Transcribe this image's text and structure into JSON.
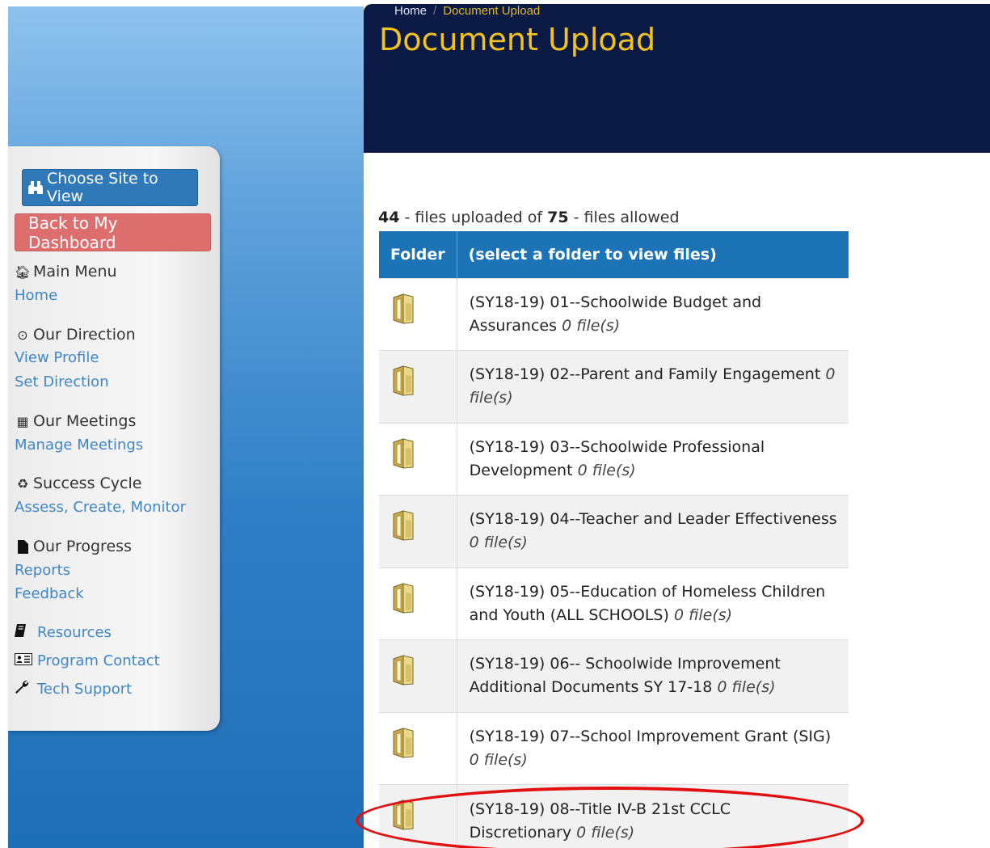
{
  "breadcrumb": {
    "home": "Home",
    "current": "Document Upload"
  },
  "page_title": "Document Upload",
  "sidebar": {
    "choose_site": "Choose Site to View",
    "back_dashboard": "Back to My Dashboard",
    "sections": [
      {
        "title": "Main Menu",
        "icon": "home-icon",
        "links": [
          "Home"
        ]
      },
      {
        "title": "Our Direction",
        "icon": "compass-icon",
        "links": [
          "View Profile",
          "Set Direction"
        ]
      },
      {
        "title": "Our Meetings",
        "icon": "calendar-icon",
        "links": [
          "Manage Meetings"
        ]
      },
      {
        "title": "Success Cycle",
        "icon": "recycle-icon",
        "links": [
          "Assess, Create, Monitor"
        ]
      },
      {
        "title": "Our Progress",
        "icon": "file-icon",
        "links": [
          "Reports",
          "Feedback"
        ]
      }
    ],
    "extra_links": [
      {
        "label": "Resources",
        "icon": "book-icon"
      },
      {
        "label": "Program Contact",
        "icon": "contact-card-icon"
      },
      {
        "label": "Tech Support",
        "icon": "wrench-icon"
      }
    ]
  },
  "summary": {
    "uploaded": "44",
    "uploaded_text": " - files uploaded of ",
    "allowed": "75",
    "allowed_text": " - files allowed"
  },
  "table": {
    "headers": [
      "Folder",
      "(select a folder to view files)"
    ],
    "rows": [
      {
        "name": "(SY18-19) 01--Schoolwide Budget and Assurances",
        "count": "0 file(s)"
      },
      {
        "name": "(SY18-19) 02--Parent and Family Engagement",
        "count": "0 file(s)"
      },
      {
        "name": "(SY18-19) 03--Schoolwide Professional Development",
        "count": "0 file(s)"
      },
      {
        "name": "(SY18-19) 04--Teacher and Leader Effectiveness",
        "count": "0 file(s)"
      },
      {
        "name": "(SY18-19) 05--Education of Homeless Children and Youth (ALL SCHOOLS)",
        "count": "0 file(s)"
      },
      {
        "name": "(SY18-19) 06-- Schoolwide Improvement Additional Documents SY 17-18",
        "count": "0 file(s)"
      },
      {
        "name": "(SY18-19) 07--School Improvement Grant (SIG)",
        "count": "0 file(s)"
      },
      {
        "name": "(SY18-19) 08--Title IV-B 21st CCLC Discretionary",
        "count": "0 file(s)"
      }
    ]
  },
  "colors": {
    "header_bg": "#0b1a45",
    "title_gold": "#f2c21d",
    "table_header": "#1c74b6",
    "primary_button": "#2f79b8",
    "danger_button": "#dd6e6e",
    "link": "#3f86c6",
    "annotation_ring": "#e10f0f"
  }
}
